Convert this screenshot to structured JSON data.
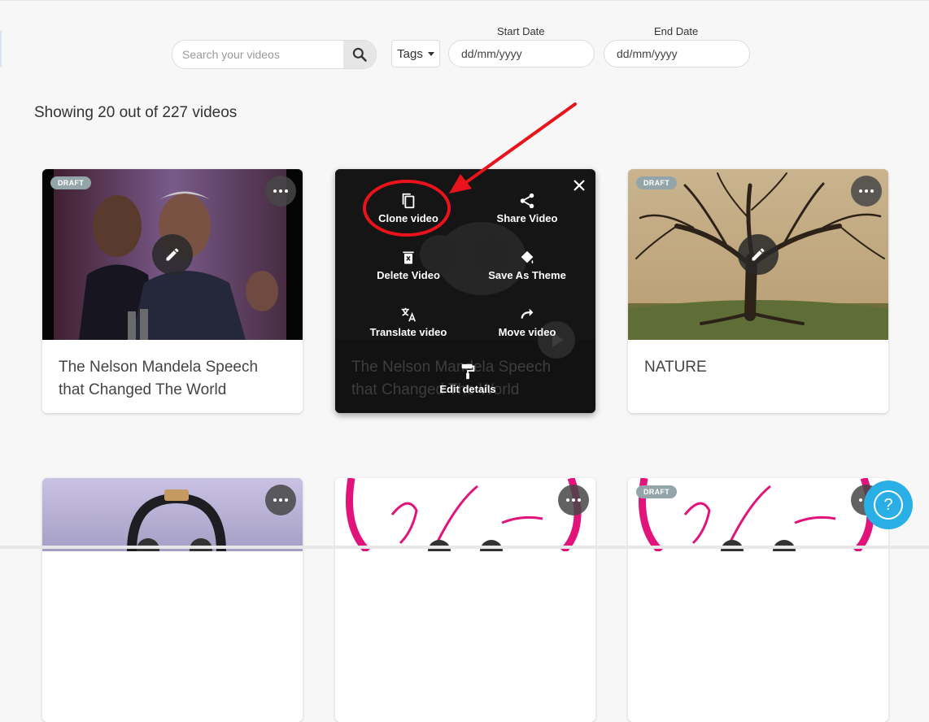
{
  "search": {
    "placeholder": "Search your videos"
  },
  "filters": {
    "tags_label": "Tags",
    "start_date_label": "Start Date",
    "start_date_value": "dd/mm/yyyy",
    "end_date_label": "End Date",
    "end_date_value": "dd/mm/yyyy"
  },
  "summary": "Showing 20 out of 227 videos",
  "cards": [
    {
      "title": "The Nelson Mandela Speech that Changed The World",
      "badge": "DRAFT"
    },
    {
      "title": "The Nelson Mandela Speech that Changed The World"
    },
    {
      "title": "NATURE",
      "badge": "DRAFT"
    }
  ],
  "menu": {
    "clone": "Clone video",
    "share": "Share Video",
    "delete": "Delete Video",
    "theme": "Save As Theme",
    "translate": "Translate video",
    "move": "Move video",
    "edit": "Edit details"
  },
  "bottom_cards": [
    {
      "badge": ""
    },
    {
      "badge": ""
    },
    {
      "badge": "DRAFT"
    }
  ],
  "colors": {
    "accent": "#29aee6",
    "annotation": "#e8131b",
    "badge": "#93a5a8"
  },
  "help": {
    "symbol": "?"
  }
}
